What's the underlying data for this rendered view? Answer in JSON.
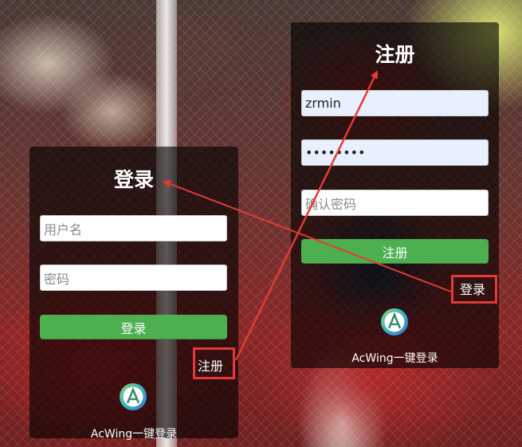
{
  "login_card": {
    "title": "登录",
    "username_placeholder": "用户名",
    "password_placeholder": "密码",
    "submit_label": "登录",
    "switch_label": "注册",
    "third_party_label": "AcWing一键登录",
    "logo_icon": "acwing-logo-icon"
  },
  "register_card": {
    "title": "注册",
    "username_value": "zrmin",
    "password_value": "••••••••",
    "confirm_placeholder": "确认密码",
    "submit_label": "注册",
    "switch_label": "登录",
    "third_party_label": "AcWing一键登录",
    "logo_icon": "acwing-logo-icon"
  },
  "annotation": {
    "color": "#e53935",
    "arrows": [
      {
        "from": "login_card.switch_label",
        "to": "register_card.title"
      },
      {
        "from": "register_card.switch_label",
        "to": "login_card.title"
      }
    ]
  },
  "colors": {
    "button": "#4caf50",
    "card_overlay": "rgba(0,0,0,0.62)",
    "autofill": "#e8f0fe"
  }
}
